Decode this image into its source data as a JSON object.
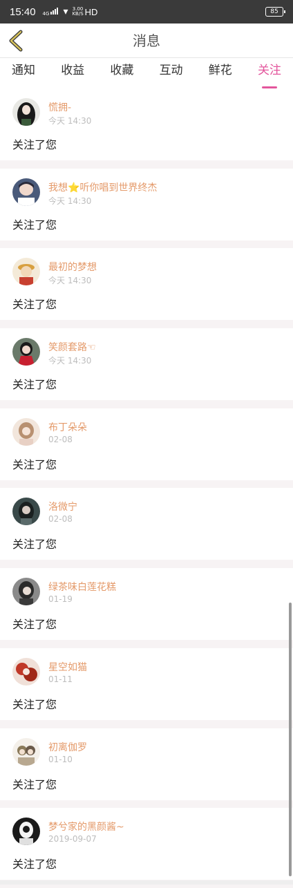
{
  "status_bar": {
    "time": "15:40",
    "network": "4G",
    "speed": "3.00",
    "speed_unit": "KB/S",
    "hd": "HD",
    "battery": "85"
  },
  "nav": {
    "title": "消息"
  },
  "tabs": [
    "通知",
    "收益",
    "收藏",
    "互动",
    "鲜花",
    "关注"
  ],
  "active_tab": 5,
  "accent_color": "#e3559c",
  "messages": [
    {
      "name": "慌拥-",
      "time": "今天 14:30",
      "text": "关注了您",
      "avatar": "girl-black-hair-avatar"
    },
    {
      "name": "我想⭐听你唱到世界终杰",
      "time": "今天 14:30",
      "text": "关注了您",
      "avatar": "boy-avatar"
    },
    {
      "name": "最初的梦想",
      "time": "今天 14:30",
      "text": "关注了您",
      "avatar": "cartoon-character-avatar"
    },
    {
      "name": "笑颜套路☜",
      "time": "今天 14:30",
      "text": "关注了您",
      "avatar": "girl-red-dress-avatar"
    },
    {
      "name": "布丁朵朵",
      "time": "02-08",
      "text": "关注了您",
      "avatar": "girl-illustration-avatar"
    },
    {
      "name": "洛微宁",
      "time": "02-08",
      "text": "关注了您",
      "avatar": "girl-dark-avatar"
    },
    {
      "name": "绿茶味白莲花糕",
      "time": "01-19",
      "text": "关注了您",
      "avatar": "girl-portrait-avatar"
    },
    {
      "name": "星空如猫",
      "time": "01-11",
      "text": "关注了您",
      "avatar": "red-illustration-avatar"
    },
    {
      "name": "初离伽罗",
      "time": "01-10",
      "text": "关注了您",
      "avatar": "anime-characters-avatar"
    },
    {
      "name": "梦兮家的黑颜酱~",
      "time": "2019-09-07",
      "text": "关注了您",
      "avatar": "bw-illustration-avatar"
    }
  ]
}
